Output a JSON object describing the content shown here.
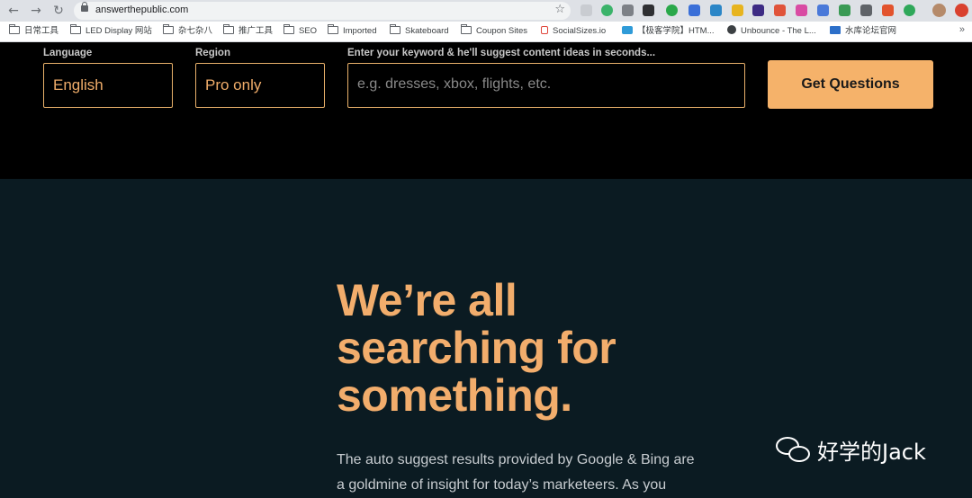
{
  "browser": {
    "url": "answerthepublic.com",
    "bookmarks": [
      {
        "label": "日常工具",
        "type": "folder"
      },
      {
        "label": "LED Display 网站",
        "type": "folder"
      },
      {
        "label": "杂七杂八",
        "type": "folder"
      },
      {
        "label": "推广工具",
        "type": "folder"
      },
      {
        "label": "SEO",
        "type": "folder"
      },
      {
        "label": "Imported",
        "type": "folder"
      },
      {
        "label": "Skateboard",
        "type": "folder"
      },
      {
        "label": "Coupon Sites",
        "type": "folder"
      },
      {
        "label": "SocialSizes.io",
        "type": "site"
      },
      {
        "label": "【极客学院】HTM...",
        "type": "site"
      },
      {
        "label": "Unbounce - The L...",
        "type": "site"
      },
      {
        "label": "水库论坛官网",
        "type": "site"
      }
    ],
    "more": "»"
  },
  "search": {
    "language_label": "Language",
    "language_value": "English",
    "region_label": "Region",
    "region_value": "Pro only",
    "keyword_label": "Enter your keyword & he'll suggest content ideas in seconds...",
    "keyword_placeholder": "e.g. dresses, xbox, flights, etc.",
    "submit_label": "Get Questions"
  },
  "hero": {
    "headline_line1": "We’re all",
    "headline_line2": "searching for",
    "headline_line3": "something.",
    "body_line1": "The auto suggest results provided by Google & Bing are",
    "body_line2": "a goldmine of insight for today’s marketeers. As you"
  },
  "watermark": {
    "text": "好学的Jack"
  },
  "colors": {
    "accent": "#f2ad6c",
    "top_bg": "#000000",
    "page_bg": "#0b1b22"
  }
}
